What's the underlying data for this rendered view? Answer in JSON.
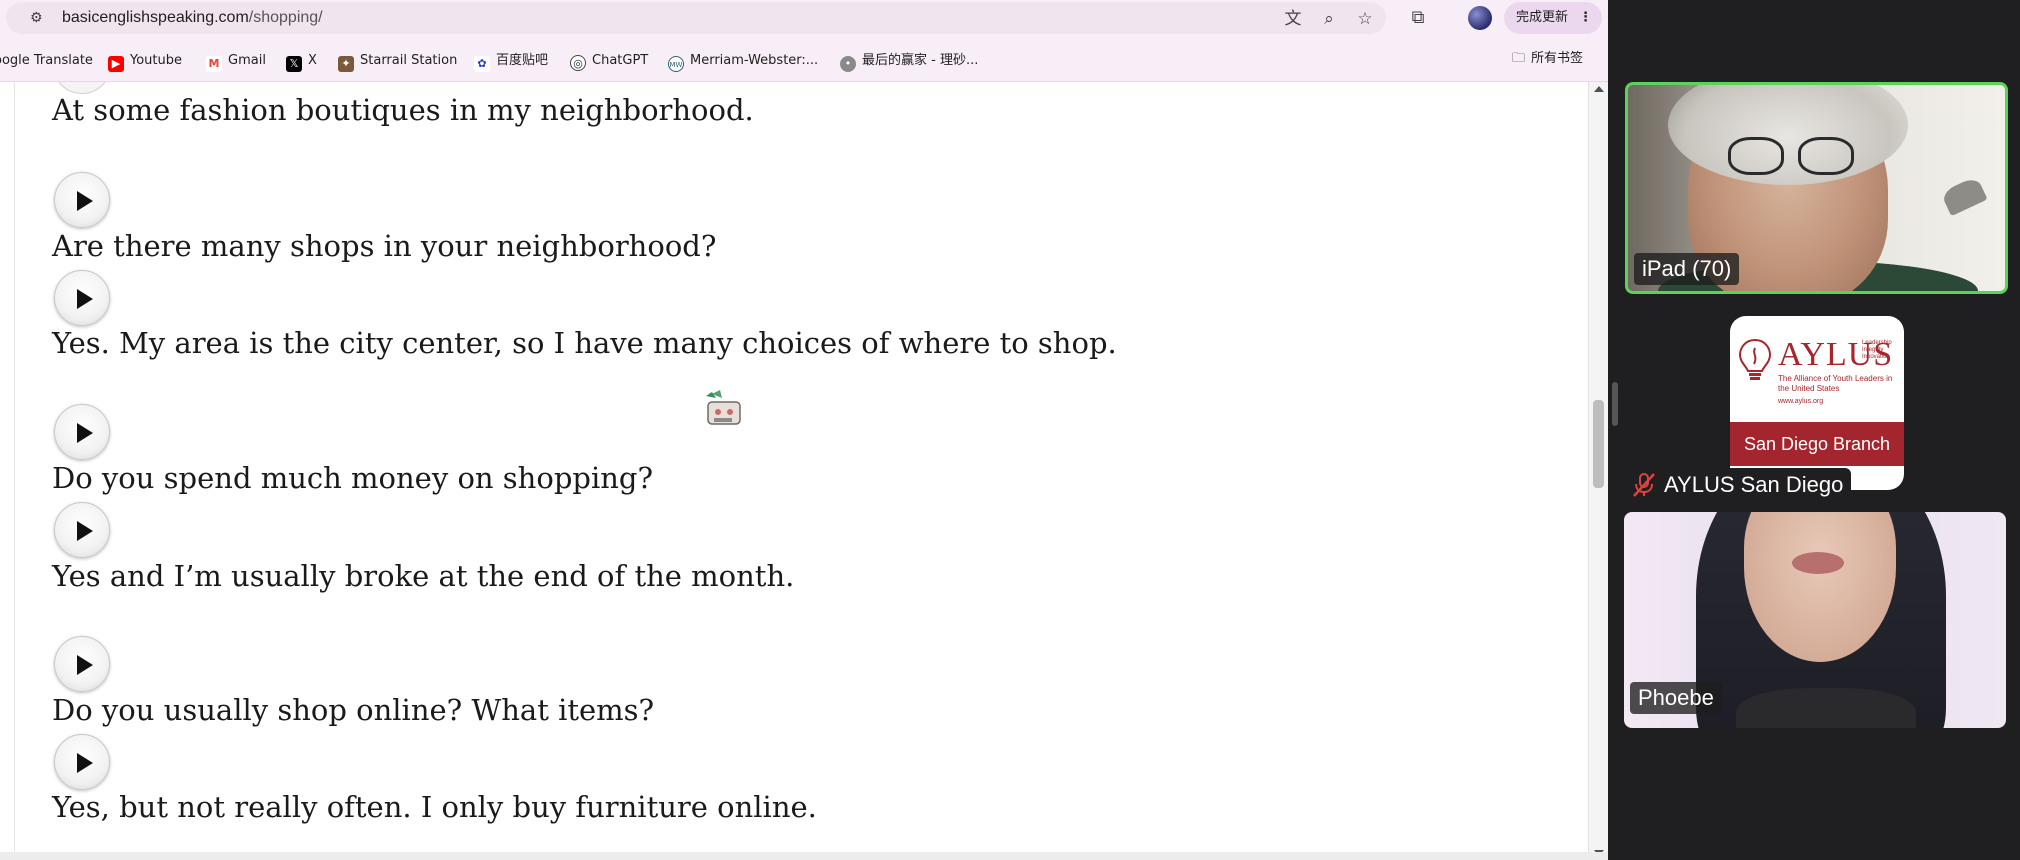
{
  "browser": {
    "url": {
      "domain": "basicenglishspeaking.com",
      "path": "/shopping/"
    },
    "toolbar_icons": [
      "translate-icon",
      "zoom-icon",
      "bookmark-star-icon",
      "extensions-icon",
      "profile-avatar"
    ],
    "update_button": "完成更新",
    "bookmarks": [
      {
        "label": "oogle Translate",
        "icon": "google-translate-icon"
      },
      {
        "label": "Youtube",
        "icon": "youtube-icon",
        "color": "#ff0000"
      },
      {
        "label": "Gmail",
        "icon": "gmail-icon",
        "color": "#ea4335"
      },
      {
        "label": "X",
        "icon": "x-icon",
        "color": "#000000"
      },
      {
        "label": "Starrail Station",
        "icon": "starrail-icon"
      },
      {
        "label": "百度贴吧",
        "icon": "baidu-icon",
        "color": "#2932e1"
      },
      {
        "label": "ChatGPT",
        "icon": "chatgpt-icon"
      },
      {
        "label": "Merriam-Webster:...",
        "icon": "merriam-webster-icon"
      },
      {
        "label": "最后的赢家 - 理砂...",
        "icon": "site-icon"
      }
    ],
    "all_bookmarks": "所有书签"
  },
  "page": {
    "lines": [
      "At some fashion boutiques in my neighborhood.",
      "Are there many shops in your neighborhood?",
      "Yes. My area is the city center, so I have many choices of where to shop.",
      "Do you spend much money on shopping?",
      "Yes and I’m usually broke at the end of the month.",
      "Do you usually shop online? What items?",
      "Yes, but not really often. I only buy furniture online."
    ]
  },
  "meeting": {
    "participants": [
      {
        "name": "iPad (70)",
        "active_speaker": true
      },
      {
        "name": "AYLUS San Diego",
        "muted": true,
        "avatar": {
          "title": "AYLUS",
          "side_text": "Leadership Integrity Innovation",
          "tagline": "The Alliance of Youth Leaders in the United States",
          "url": "www.aylus.org",
          "banner": "San Diego Branch"
        }
      },
      {
        "name": "Phoebe"
      }
    ],
    "colors": {
      "active_border": "#5ad35a",
      "brand_red": "#a3262e"
    }
  }
}
